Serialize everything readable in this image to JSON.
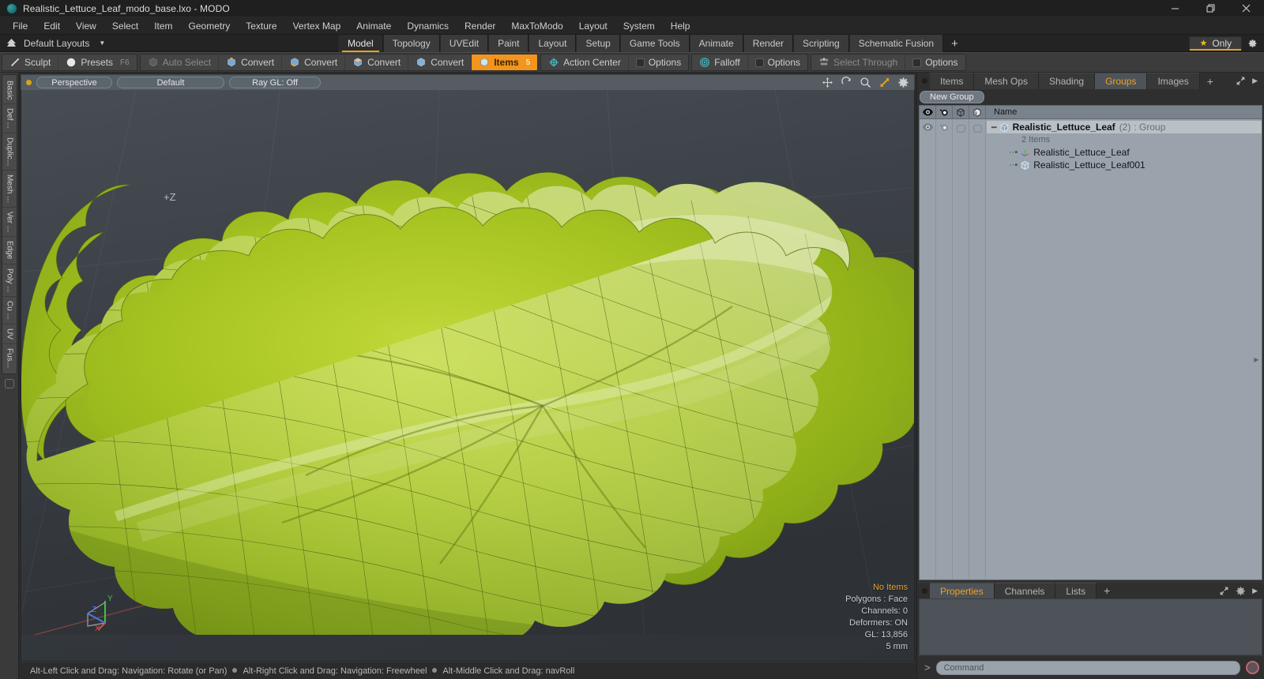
{
  "window": {
    "title": "Realistic_Lettuce_Leaf_modo_base.lxo - MODO",
    "logo_icon": "modo-logo-icon",
    "minimize_label": "─",
    "maximize_label": "❐",
    "close_label": "✕"
  },
  "menubar": {
    "items": [
      {
        "label": "File"
      },
      {
        "label": "Edit"
      },
      {
        "label": "View"
      },
      {
        "label": "Select"
      },
      {
        "label": "Item"
      },
      {
        "label": "Geometry"
      },
      {
        "label": "Texture"
      },
      {
        "label": "Vertex Map"
      },
      {
        "label": "Animate"
      },
      {
        "label": "Dynamics"
      },
      {
        "label": "Render"
      },
      {
        "label": "MaxToModo"
      },
      {
        "label": "Layout"
      },
      {
        "label": "System"
      },
      {
        "label": "Help"
      }
    ]
  },
  "layoutbar": {
    "home_icon": "home-icon",
    "layouts_label": "Default Layouts",
    "caret_icon": "chevron-down-icon",
    "tabs": [
      {
        "label": "Model",
        "active": true
      },
      {
        "label": "Topology",
        "active": false
      },
      {
        "label": "UVEdit",
        "active": false
      },
      {
        "label": "Paint",
        "active": false
      },
      {
        "label": "Layout",
        "active": false
      },
      {
        "label": "Setup",
        "active": false
      },
      {
        "label": "Game Tools",
        "active": false
      },
      {
        "label": "Animate",
        "active": false
      },
      {
        "label": "Render",
        "active": false
      },
      {
        "label": "Scripting",
        "active": false
      },
      {
        "label": "Schematic Fusion",
        "active": false
      }
    ],
    "add_tab_label": "+",
    "only_label": "Only",
    "star_icon": "star-icon",
    "settings_icon": "gear-icon"
  },
  "toolbar": {
    "groups": [
      {
        "buttons": [
          {
            "label": "Sculpt",
            "icon": "pencil-icon",
            "state": "normal",
            "shortcut": ""
          },
          {
            "label": "Presets",
            "icon": "sphere-icon",
            "state": "normal",
            "shortcut": "F6"
          }
        ]
      },
      {
        "buttons": [
          {
            "label": "Auto Select",
            "icon": "cube-gray-icon",
            "state": "disabled",
            "shortcut": ""
          },
          {
            "label": "Convert",
            "icon": "cube-vertex-icon",
            "state": "normal",
            "shortcut": ""
          },
          {
            "label": "Convert",
            "icon": "cube-edge-icon",
            "state": "normal",
            "shortcut": ""
          },
          {
            "label": "Convert",
            "icon": "cube-poly-icon",
            "state": "normal",
            "shortcut": ""
          },
          {
            "label": "Convert",
            "icon": "cube-material-icon",
            "state": "normal",
            "shortcut": ""
          },
          {
            "label": "Items",
            "icon": "cube-items-icon",
            "state": "active",
            "shortcut": "5"
          }
        ]
      },
      {
        "buttons": [
          {
            "label": "Action Center",
            "icon": "action-center-icon",
            "state": "normal",
            "shortcut": ""
          },
          {
            "label": "Options",
            "icon": "options-square-icon",
            "state": "normal",
            "shortcut": ""
          }
        ]
      },
      {
        "buttons": [
          {
            "label": "Falloff",
            "icon": "falloff-icon",
            "state": "normal",
            "shortcut": ""
          },
          {
            "label": "Options",
            "icon": "options-square-icon",
            "state": "normal",
            "shortcut": ""
          }
        ]
      },
      {
        "buttons": [
          {
            "label": "Select Through",
            "icon": "select-through-icon",
            "state": "disabled",
            "shortcut": ""
          },
          {
            "label": "Options",
            "icon": "options-square-icon",
            "state": "normal",
            "shortcut": ""
          }
        ]
      }
    ]
  },
  "left_strip": {
    "tabs": [
      {
        "label": "Basic"
      },
      {
        "label": "Def ..."
      },
      {
        "label": "Duplic..."
      },
      {
        "label": "Mesh ..."
      },
      {
        "label": "Ver ..."
      },
      {
        "label": "Edge"
      },
      {
        "label": "Poly ..."
      },
      {
        "label": "Cu ..."
      },
      {
        "label": "UV"
      },
      {
        "label": "Fus..."
      }
    ]
  },
  "viewport": {
    "header": {
      "view_mode": "Perspective",
      "shading_preset": "Default",
      "ray_gl": "Ray GL: Off",
      "icons": [
        {
          "name": "pan-icon"
        },
        {
          "name": "rotate-icon"
        },
        {
          "name": "zoom-icon"
        },
        {
          "name": "fit-icon"
        },
        {
          "name": "viewport-settings-gear-icon"
        }
      ]
    },
    "axis_label_z": "+Z",
    "gizmo": {
      "x_label": "X",
      "y_label": "Y",
      "z_label": "Z"
    },
    "stats": {
      "selection": "No Items",
      "polygons": "Polygons : Face",
      "channels": "Channels: 0",
      "deformers": "Deformers: ON",
      "gl": "GL: 13,856",
      "grid": "5 mm"
    },
    "colors": {
      "leaf_light": "#b6cf2c",
      "leaf_mid": "#93b31c",
      "leaf_dark": "#6f8c14",
      "wire": "#3a4a0c",
      "background_top": "#41474d",
      "background_bottom": "#2f3338"
    }
  },
  "statusbar": {
    "hint_1": "Alt-Left Click and Drag: Navigation: Rotate (or Pan)",
    "hint_2": "Alt-Right Click and Drag: Navigation: Freewheel",
    "hint_3": "Alt-Middle Click and Drag: navRoll"
  },
  "right_panel": {
    "tabs": [
      {
        "label": "Items",
        "active": false
      },
      {
        "label": "Mesh Ops",
        "active": false
      },
      {
        "label": "Shading",
        "active": false
      },
      {
        "label": "Groups",
        "active": true
      },
      {
        "label": "Images",
        "active": false
      }
    ],
    "add_tab_label": "+",
    "expand_icon": "expand-icon",
    "more_icon": "chevron-right-icon",
    "new_group_label": "New Group",
    "tree": {
      "columns": [
        {
          "name": "visibility-eye-icon"
        },
        {
          "name": "render-eye-icon"
        },
        {
          "name": "cube-outline-icon"
        },
        {
          "name": "cube-shaded-icon"
        }
      ],
      "name_header": "Name",
      "rows": [
        {
          "name": "Realistic_Lettuce_Leaf",
          "count": "(2)",
          "type": ": Group",
          "icon": "group-cube-icon",
          "selected": true,
          "depth": 0
        },
        {
          "name": "2 Items",
          "icon": "",
          "selected": false,
          "depth": 1,
          "muted": true
        },
        {
          "name": "Realistic_Lettuce_Leaf",
          "icon": "locator-axis-icon",
          "selected": false,
          "depth": 1
        },
        {
          "name": "Realistic_Lettuce_Leaf001",
          "icon": "mesh-cube-icon",
          "selected": false,
          "depth": 1
        }
      ]
    },
    "bottom_tabs": [
      {
        "label": "Properties",
        "active": true
      },
      {
        "label": "Channels",
        "active": false
      },
      {
        "label": "Lists",
        "active": false
      }
    ],
    "bottom_add_label": "+",
    "command": {
      "prompt": ">",
      "placeholder": "Command",
      "value": "",
      "record_icon": "record-circle-icon"
    }
  }
}
